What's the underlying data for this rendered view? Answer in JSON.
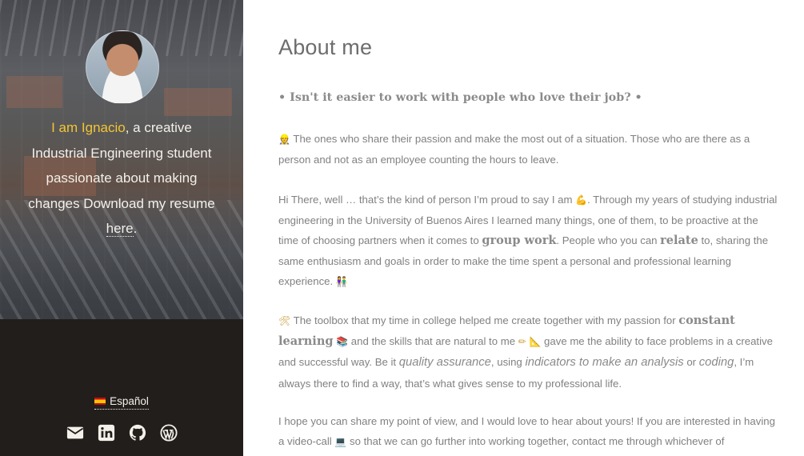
{
  "sidebar": {
    "intro_highlight": "I am Ignacio",
    "intro_text": ", a creative Industrial Engineering student passionate about making changes Download my resume ",
    "resume_link": "here",
    "intro_end": ".",
    "language_label": "Español"
  },
  "social": {
    "icons": [
      "email-icon",
      "linkedin-icon",
      "github-icon",
      "wordpress-icon"
    ]
  },
  "main": {
    "title": "About me",
    "tagline_prefix": "• ",
    "tagline": "Isn't it easier to work with people who love their job",
    "tagline_suffix": "? •",
    "p1": "The ones who share their passion and make the most out of a situation. Those who are there as a person and not as an employee counting the hours to leave.",
    "p2_a": "Hi There, well … that’s the kind of person I’m proud to say I am ",
    "p2_b": ". Through my years of studying industrial engineering in the University of Buenos Aires I learned many things, one of them, to be proactive at the time of choosing partners when it comes to ",
    "p2_group_work": "group work",
    "p2_c": ". People who you can ",
    "p2_relate": "relate",
    "p2_d": " to, sharing the same enthusiasm and goals in order to make the time spent a personal and professional learning experience.",
    "p3_a": "The toolbox that my time in college helped me create together with my passion for ",
    "p3_constant_learning": "constant learning",
    "p3_b": " and the skills that are natural to me ",
    "p3_c": " gave me the ability to face problems in a creative and successful way. Be it ",
    "p3_quality": "quality assurance",
    "p3_d": ", using ",
    "p3_indicators": "indicators to make an analysis",
    "p3_e": " or ",
    "p3_coding": "coding",
    "p3_f": ", I’m always there to find a way, that’s what gives sense to my professional life.",
    "p4_a": "I hope you can share my point of view, and I would love to hear about yours! If you are interested in having a video-call ",
    "p4_b": " so that we can go further into working together, contact me through whichever of"
  },
  "colors": {
    "accent": "#f2c533",
    "sidebar_bg": "#221e1b",
    "text": "#818181"
  }
}
